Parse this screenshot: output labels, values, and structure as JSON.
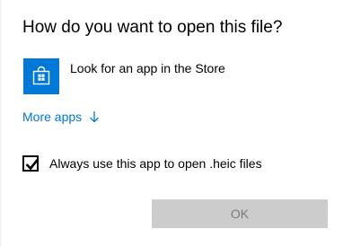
{
  "dialog": {
    "title": "How do you want to open this file?",
    "store_option": {
      "label": "Look for an app in the Store",
      "icon": "store-bag-icon"
    },
    "more_apps": {
      "label": "More apps",
      "icon": "arrow-down-icon"
    },
    "always_use": {
      "label": "Always use this app to open .heic files",
      "checked": true
    },
    "ok_button": {
      "label": "OK",
      "enabled": false
    }
  },
  "colors": {
    "accent": "#0078d7",
    "disabled_button_bg": "#cccccc",
    "disabled_button_text": "#7a7a7a"
  }
}
